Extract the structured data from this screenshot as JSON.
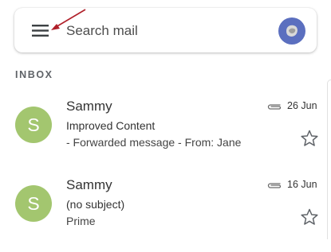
{
  "search": {
    "placeholder": "Search mail"
  },
  "inbox": {
    "label": "INBOX",
    "emails": [
      {
        "avatar_letter": "S",
        "sender": "Sammy",
        "subject": "Improved Content",
        "snippet": "- Forwarded message - From: Jane",
        "date": "26 Jun",
        "has_attachment": true,
        "starred": false
      },
      {
        "avatar_letter": "S",
        "sender": "Sammy",
        "subject": "(no subject)",
        "snippet": "Prime",
        "date": "16 Jun",
        "has_attachment": true,
        "starred": false
      }
    ]
  },
  "colors": {
    "avatar_sender": "#a3c66f",
    "account_avatar": "#5b6fbf",
    "annotation_arrow": "#b0202a"
  },
  "icons": [
    "menu-icon",
    "account-avatar-icon",
    "paperclip-icon",
    "star-icon"
  ]
}
